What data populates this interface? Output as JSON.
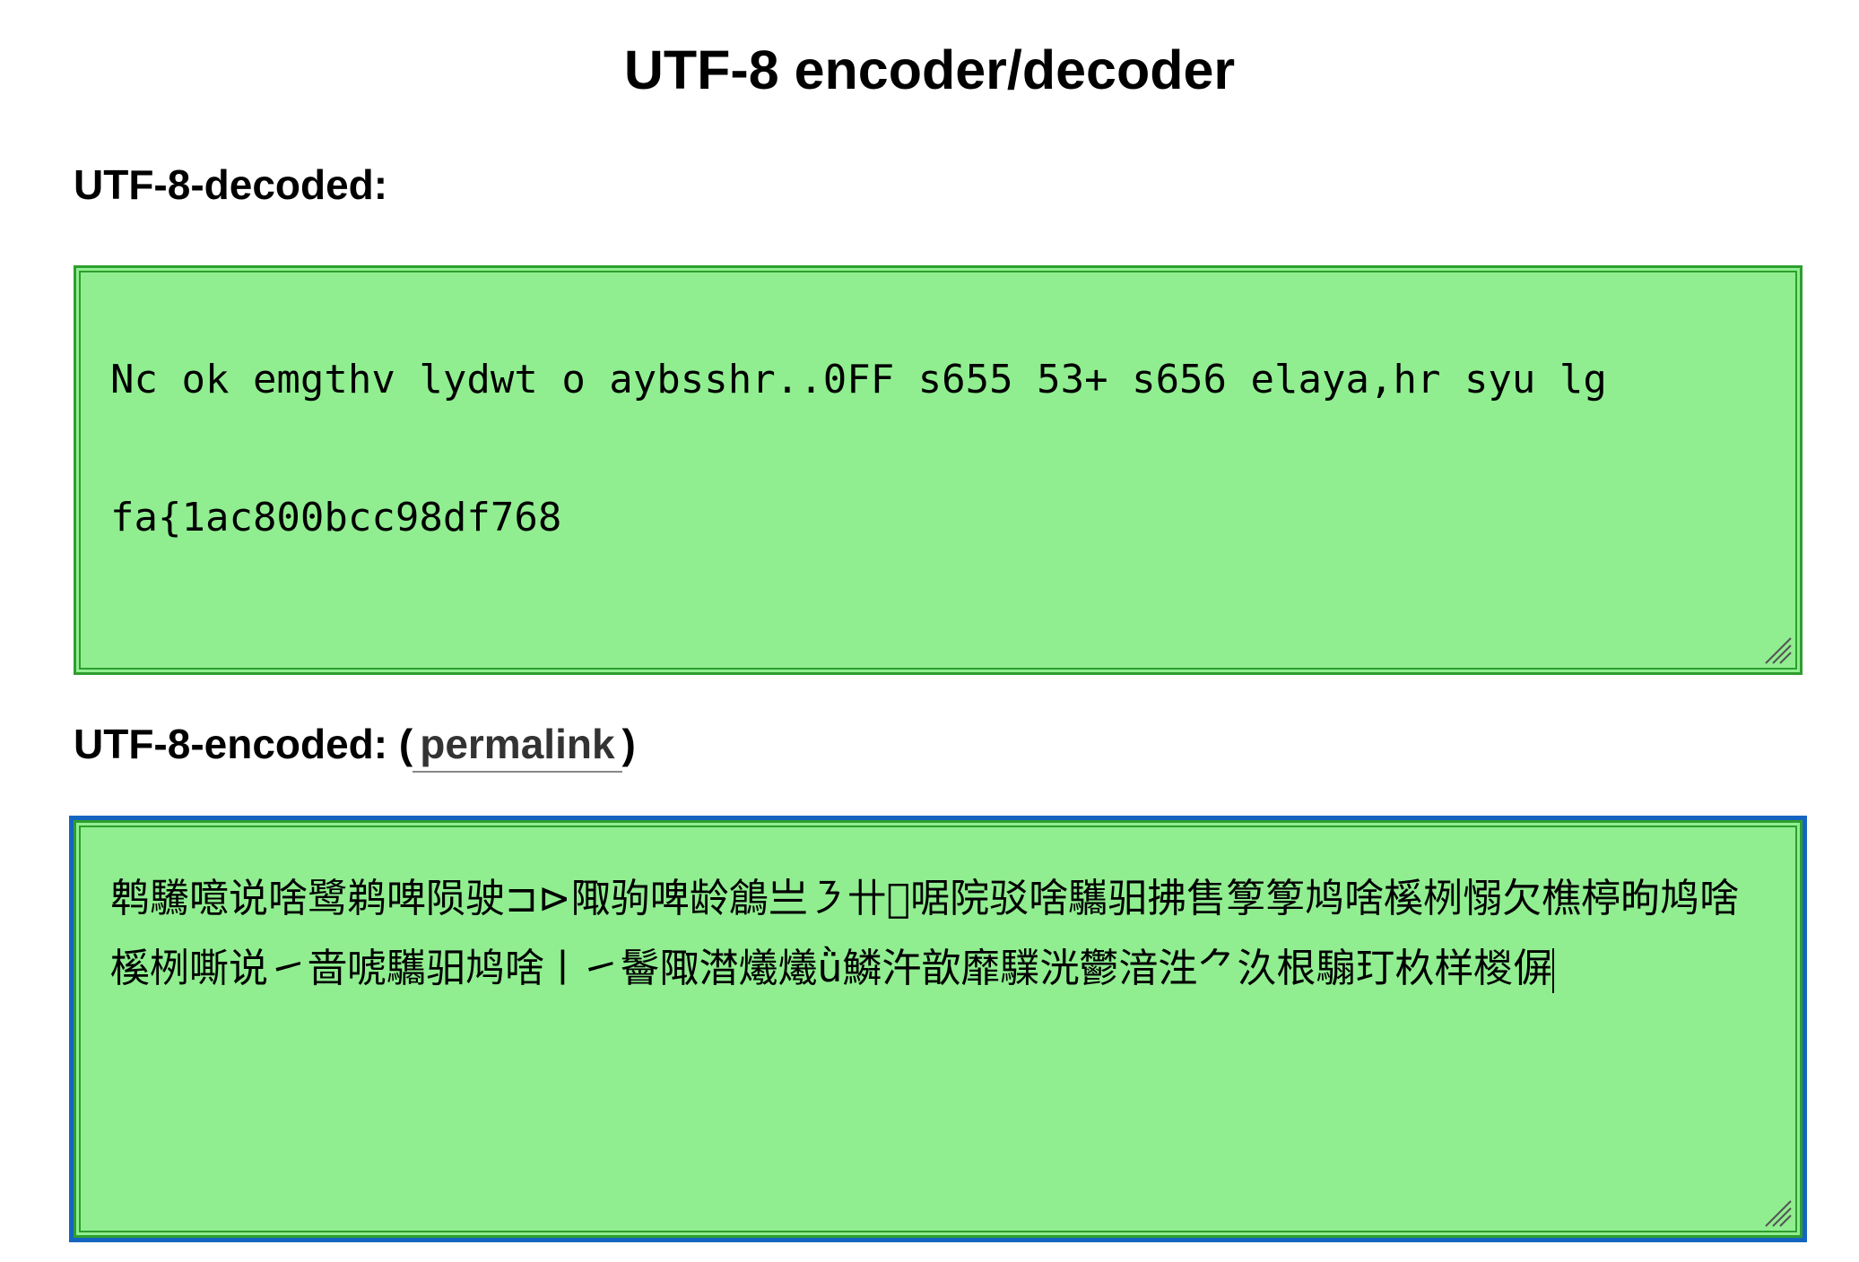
{
  "page": {
    "title": "UTF-8 encoder/decoder"
  },
  "decoded": {
    "label": "UTF-8-decoded:",
    "text": "Nc ok emgthv lydwt o aybsshr..0FF s655 53+ s656 elaya,hr syu lg\nfa{1ac800bcc98df768"
  },
  "encoded": {
    "label": "UTF-8-encoded:",
    "paren_open": "(",
    "permalink_label": "permalink",
    "paren_close": ")",
    "text": "鹎驣󠄁噫说啥鹭鹈啤陨驶⊐⊳陬驹啤龄鶬亗㇋卄﷑啹院驳啥驨驲拂售󠄂箰箰鸠啥榽栵愵欠樵楟昫鸠啥榽栵嘶说㇀啬󠄃󠄄󠄅唬驨驲鸠啥ㅣ㇀鬠陬澘爔爔ǜ鱗汻歆靡驜洸鬱湆泩⺈汣根騸玎杦样椶偋"
  },
  "colors": {
    "box_background": "#90ee90",
    "box_border": "#2e9e2e",
    "focus_outline": "#1565c0"
  }
}
